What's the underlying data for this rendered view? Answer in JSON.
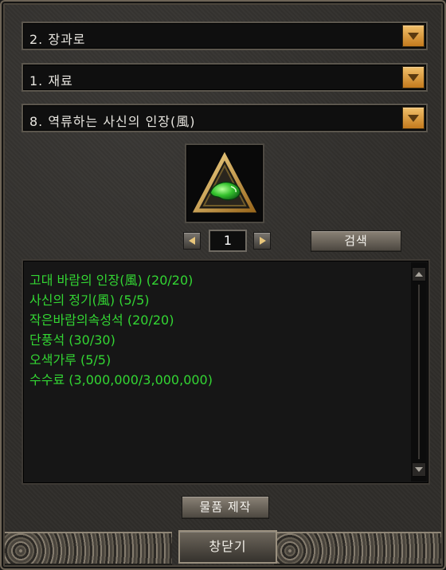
{
  "dropdowns": [
    {
      "selected": "2. 장과로"
    },
    {
      "selected": "1. 재료"
    },
    {
      "selected": "8. 역류하는 사신의 인장(風)"
    }
  ],
  "item_icon": "green-gem-triangle-seal-icon",
  "pager": {
    "page": "1"
  },
  "buttons": {
    "search": "검색",
    "craft": "물품 제작",
    "close": "창닫기"
  },
  "materials": [
    "고대 바람의 인장(風) (20/20)",
    "사신의 정기(風) (5/5)",
    "작은바람의속성석 (20/20)",
    "단풍석 (30/30)",
    "오색가루 (5/5)",
    "수수료 (3,000,000/3,000,000)"
  ],
  "colors": {
    "material_text": "#33d633",
    "dropdown_button": "#e4a23e"
  }
}
